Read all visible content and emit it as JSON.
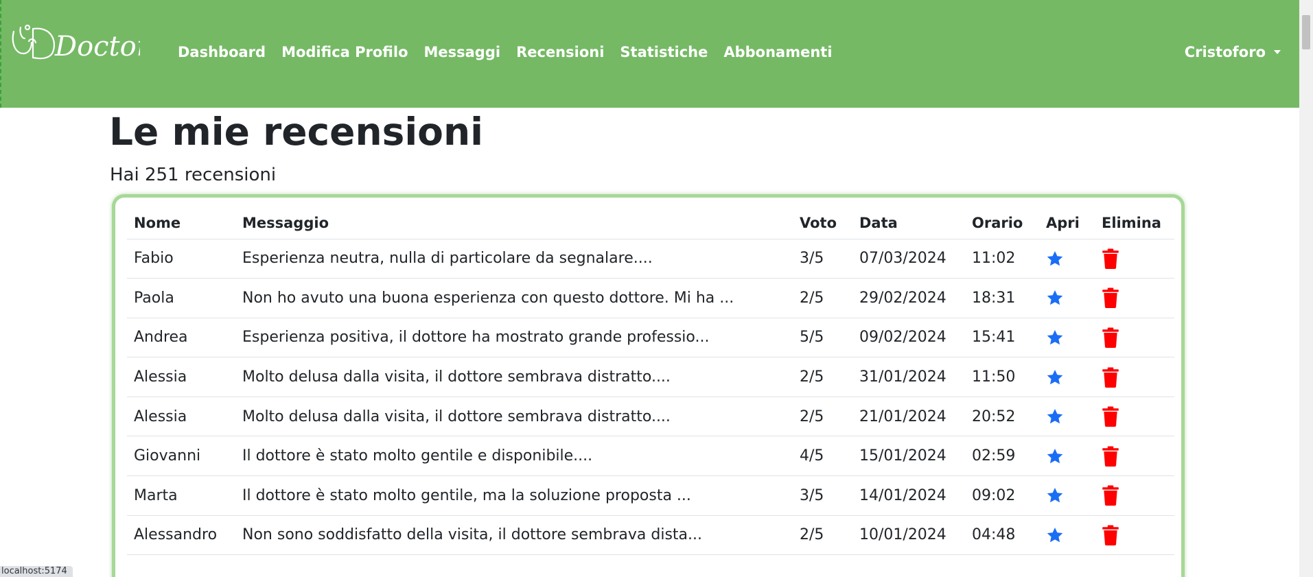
{
  "app": {
    "logo_text": "Doctors"
  },
  "nav": {
    "items": [
      {
        "label": "Dashboard"
      },
      {
        "label": "Modifica Profilo"
      },
      {
        "label": "Messaggi"
      },
      {
        "label": "Recensioni"
      },
      {
        "label": "Statistiche"
      },
      {
        "label": "Abbonamenti"
      }
    ],
    "user": "Cristoforo"
  },
  "page": {
    "title": "Le mie recensioni",
    "subtitle": "Hai 251 recensioni"
  },
  "table": {
    "headers": {
      "nome": "Nome",
      "messaggio": "Messaggio",
      "voto": "Voto",
      "data": "Data",
      "orario": "Orario",
      "apri": "Apri",
      "elimina": "Elimina"
    },
    "rows": [
      {
        "nome": "Fabio",
        "messaggio": "Esperienza neutra, nulla di particolare da segnalare....",
        "voto": "3/5",
        "data": "07/03/2024",
        "orario": "11:02"
      },
      {
        "nome": "Paola",
        "messaggio": "Non ho avuto una buona esperienza con questo dottore. Mi ha ...",
        "voto": "2/5",
        "data": "29/02/2024",
        "orario": "18:31"
      },
      {
        "nome": "Andrea",
        "messaggio": "Esperienza positiva, il dottore ha mostrato grande professio...",
        "voto": "5/5",
        "data": "09/02/2024",
        "orario": "15:41"
      },
      {
        "nome": "Alessia",
        "messaggio": "Molto delusa dalla visita, il dottore sembrava distratto....",
        "voto": "2/5",
        "data": "31/01/2024",
        "orario": "11:50"
      },
      {
        "nome": "Alessia",
        "messaggio": "Molto delusa dalla visita, il dottore sembrava distratto....",
        "voto": "2/5",
        "data": "21/01/2024",
        "orario": "20:52"
      },
      {
        "nome": "Giovanni",
        "messaggio": "Il dottore è stato molto gentile e disponibile....",
        "voto": "4/5",
        "data": "15/01/2024",
        "orario": "02:59"
      },
      {
        "nome": "Marta",
        "messaggio": "Il dottore è stato molto gentile, ma la soluzione proposta ...",
        "voto": "3/5",
        "data": "14/01/2024",
        "orario": "09:02"
      },
      {
        "nome": "Alessandro",
        "messaggio": "Non sono soddisfatto della visita, il dottore sembrava dista...",
        "voto": "2/5",
        "data": "10/01/2024",
        "orario": "04:48"
      }
    ]
  },
  "icons": {
    "open": "star-icon",
    "delete": "trash-icon"
  },
  "colors": {
    "navbar": "#75b965",
    "card_border": "#a7d896",
    "star": "#1a6ef5",
    "trash": "#ff0000"
  },
  "statusbar": {
    "url": "localhost:5174"
  }
}
